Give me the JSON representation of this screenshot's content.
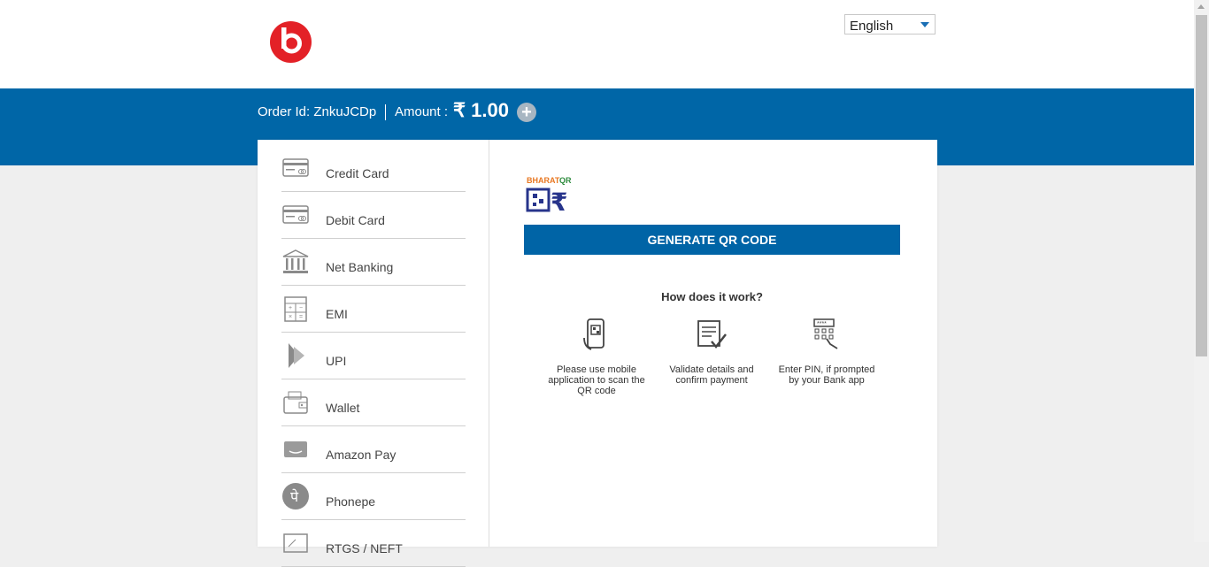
{
  "header": {
    "language": "English"
  },
  "order": {
    "order_label": "Order Id: ZnkuJCDp",
    "amount_label": "Amount :",
    "amount_value": "₹ 1.00",
    "plus_symbol": "+"
  },
  "payment_methods": [
    {
      "label": "Credit Card",
      "icon": "credit-card-icon"
    },
    {
      "label": "Debit Card",
      "icon": "debit-card-icon"
    },
    {
      "label": "Net Banking",
      "icon": "bank-icon"
    },
    {
      "label": "EMI",
      "icon": "calculator-icon"
    },
    {
      "label": "UPI",
      "icon": "upi-icon"
    },
    {
      "label": "Wallet",
      "icon": "wallet-icon"
    },
    {
      "label": "Amazon Pay",
      "icon": "amazon-pay-icon"
    },
    {
      "label": "Phonepe",
      "icon": "phonepe-icon"
    },
    {
      "label": "RTGS / NEFT",
      "icon": "rtgs-icon"
    }
  ],
  "qr": {
    "brand_text": "BHARATQR",
    "generate_button": "GENERATE QR CODE",
    "how_title": "How does it work?",
    "steps": [
      {
        "text": "Please use mobile application to scan the QR code",
        "icon": "phone-scan-icon"
      },
      {
        "text": "Validate details and confirm payment",
        "icon": "document-check-icon"
      },
      {
        "text": "Enter PIN, if prompted by your Bank app",
        "icon": "keypad-icon"
      }
    ]
  },
  "colors": {
    "brand_blue": "#0066a7",
    "button_blue": "#0064a6",
    "logo_red": "#e32127"
  }
}
